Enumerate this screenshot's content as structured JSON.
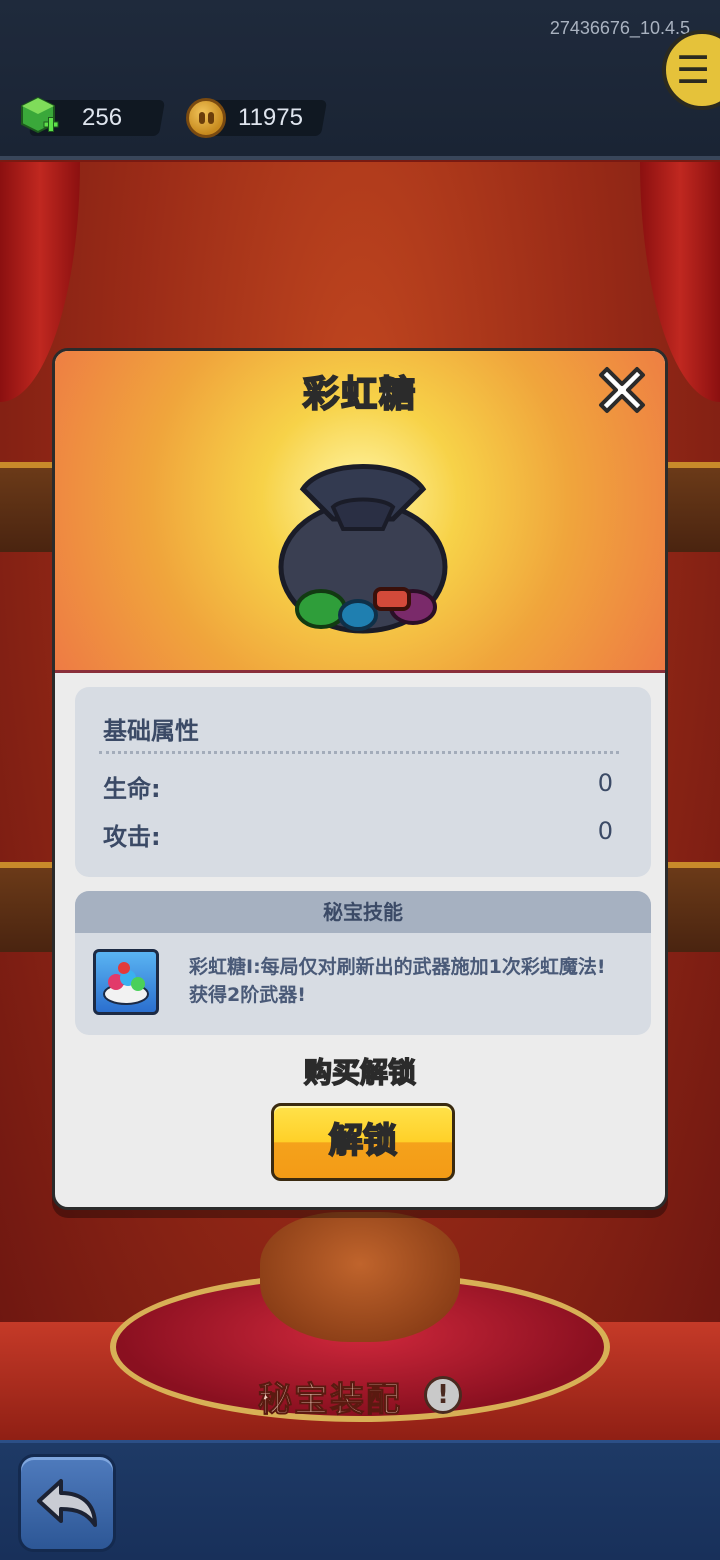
{
  "topbar": {
    "version": "27436676_10.4.5",
    "gems": "256",
    "coins": "11975"
  },
  "stage": {
    "label": "秘宝装配",
    "info_glyph": "!"
  },
  "modal": {
    "title": "彩虹糖",
    "attributes": {
      "heading": "基础属性",
      "rows": [
        {
          "label": "生命:",
          "value": "0"
        },
        {
          "label": "攻击:",
          "value": "0"
        }
      ]
    },
    "skill": {
      "heading": "秘宝技能",
      "description": "彩虹糖Ⅰ:每局仅对刷新出的武器施加1次彩虹魔法!获得2阶武器!"
    },
    "unlock_label": "购买解锁",
    "unlock_button": "解锁"
  },
  "icons": {
    "gem": "green-gem-plus-icon",
    "coin": "gold-coin-icon",
    "close": "close-x-icon",
    "item": "candy-bag-icon",
    "skill": "rainbow-candy-bowl-icon",
    "back": "back-arrow-icon",
    "info": "info-exclamation-icon"
  },
  "colors": {
    "accent_yellow": "#ffd028",
    "header_orange": "#ee7b44",
    "panel_bg": "#d7dce3",
    "text_slate": "#3b4a66"
  }
}
